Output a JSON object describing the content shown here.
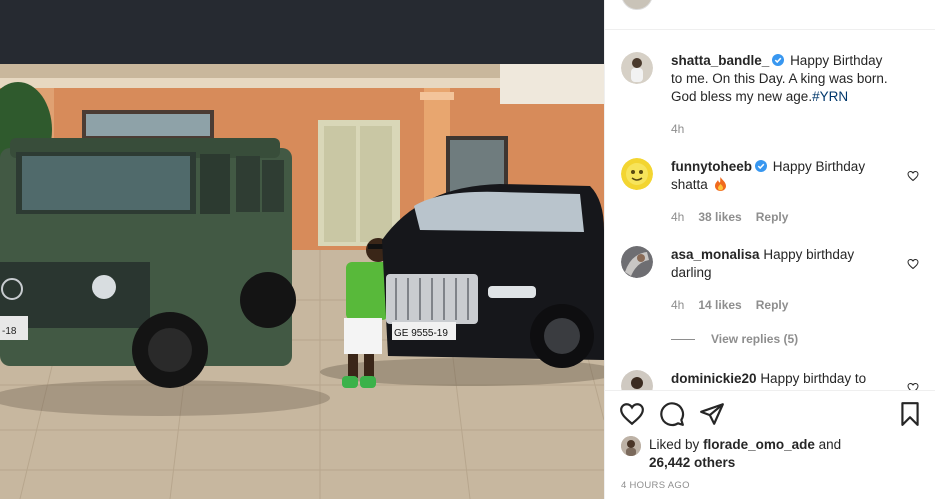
{
  "post": {
    "caption": {
      "username": "shatta_bandle_",
      "text": "Happy Birthday to me. On this Day. A king was born. God bless my new age.",
      "hashtag": "#YRN",
      "time": "4h"
    },
    "comments": [
      {
        "username": "funnytoheeb",
        "verified": true,
        "text": "Happy Birthday shatta",
        "time": "4h",
        "likes": "38 likes",
        "reply": "Reply"
      },
      {
        "username": "asa_monalisa",
        "verified": false,
        "text": "Happy birthday darling",
        "time": "4h",
        "likes": "14 likes",
        "reply": "Reply",
        "view_replies": "View replies (5)"
      },
      {
        "username": "dominickie20",
        "verified": false,
        "text": "Happy birthday to"
      }
    ],
    "likes": {
      "prefix": "Liked by",
      "user": "florade_omo_ade",
      "and": "and",
      "others": "26,442 others"
    },
    "timestamp": "4 HOURS AGO"
  },
  "photo": {
    "plate_left": "-18",
    "plate_right": "GE 9555-19"
  },
  "icons": {
    "verified": "verified-badge-icon",
    "heart": "heart-icon",
    "comment": "comment-icon",
    "share": "share-icon",
    "save": "bookmark-icon",
    "fire": "fire-emoji-icon"
  },
  "colors": {
    "text": "#262626",
    "muted": "#8e8e8e",
    "verified": "#3897f0",
    "hashtag": "#00376b",
    "divider": "#efefef"
  }
}
